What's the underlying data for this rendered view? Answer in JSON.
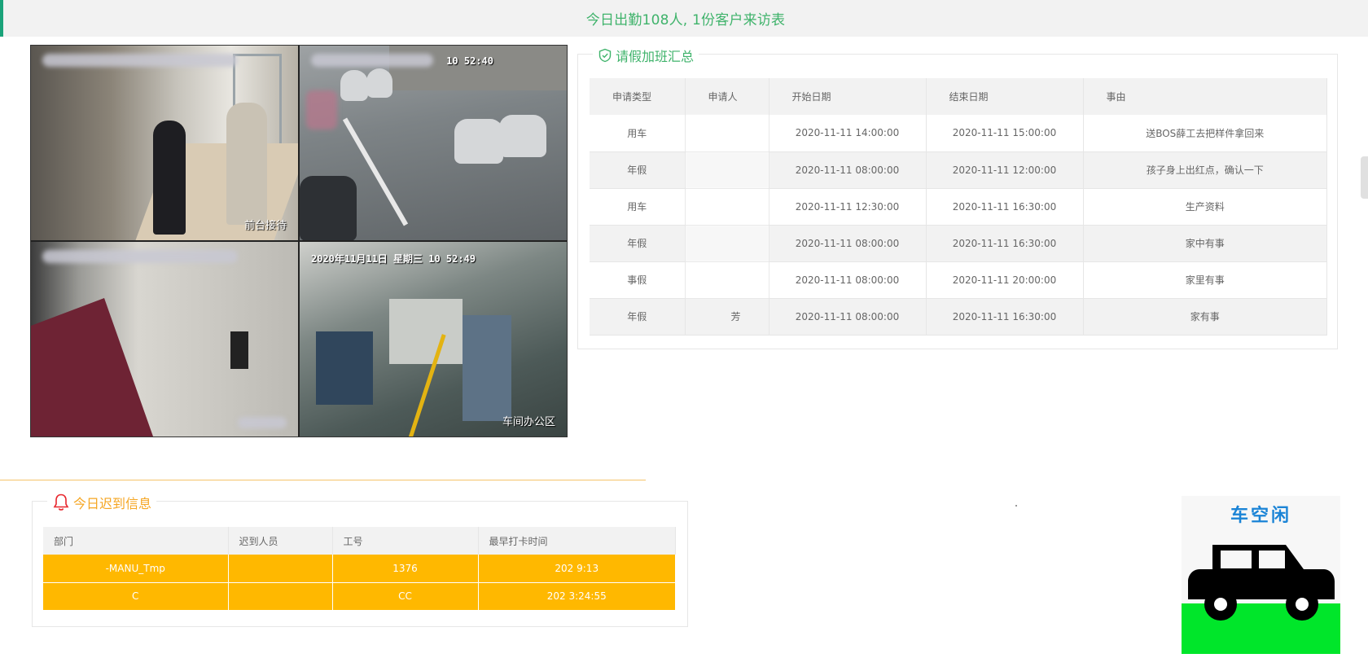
{
  "banner": {
    "text": "今日出勤108人, 1份客户来访表"
  },
  "cctv": {
    "cameras": [
      {
        "timestamp": "",
        "location": "前台接待"
      },
      {
        "timestamp": "10 52:40",
        "location": ""
      },
      {
        "timestamp": "",
        "location": ""
      },
      {
        "timestamp": "2020年11月11日 星期三 10 52:49",
        "location": "车间办公区"
      }
    ]
  },
  "leave_summary": {
    "title": "请假加班汇总",
    "headers": [
      "申请类型",
      "申请人",
      "开始日期",
      "结束日期",
      "事由"
    ],
    "rows": [
      [
        "用车",
        "",
        "2020-11-11 14:00:00",
        "2020-11-11 15:00:00",
        "送BOS薛工去把样件拿回来"
      ],
      [
        "年假",
        "",
        "2020-11-11 08:00:00",
        "2020-11-11 12:00:00",
        "孩子身上出红点，确认一下"
      ],
      [
        "用车",
        "",
        "2020-11-11 12:30:00",
        "2020-11-11 16:30:00",
        "生产资料"
      ],
      [
        "年假",
        "",
        "2020-11-11 08:00:00",
        "2020-11-11 16:30:00",
        "家中有事"
      ],
      [
        "事假",
        "",
        "2020-11-11 08:00:00",
        "2020-11-11 20:00:00",
        "家里有事"
      ],
      [
        "年假",
        "芳",
        "2020-11-11 08:00:00",
        "2020-11-11 16:30:00",
        "家有事"
      ]
    ]
  },
  "late_info": {
    "title": "今日迟到信息",
    "headers": [
      "部门",
      "迟到人员",
      "工号",
      "最早打卡时间"
    ],
    "rows": [
      [
        "-MANU_Tmp",
        "",
        "1376",
        "202 9:13"
      ],
      [
        "C",
        "",
        "CC",
        "202 3:24:55"
      ]
    ]
  },
  "car_status": {
    "label": "车空闲"
  },
  "colors": {
    "accent_green": "#3fb36b",
    "late_orange": "#ffb800",
    "legend_orange": "#f5a623",
    "car_title_blue": "#1b84d6",
    "grass_green": "#00e62a"
  }
}
